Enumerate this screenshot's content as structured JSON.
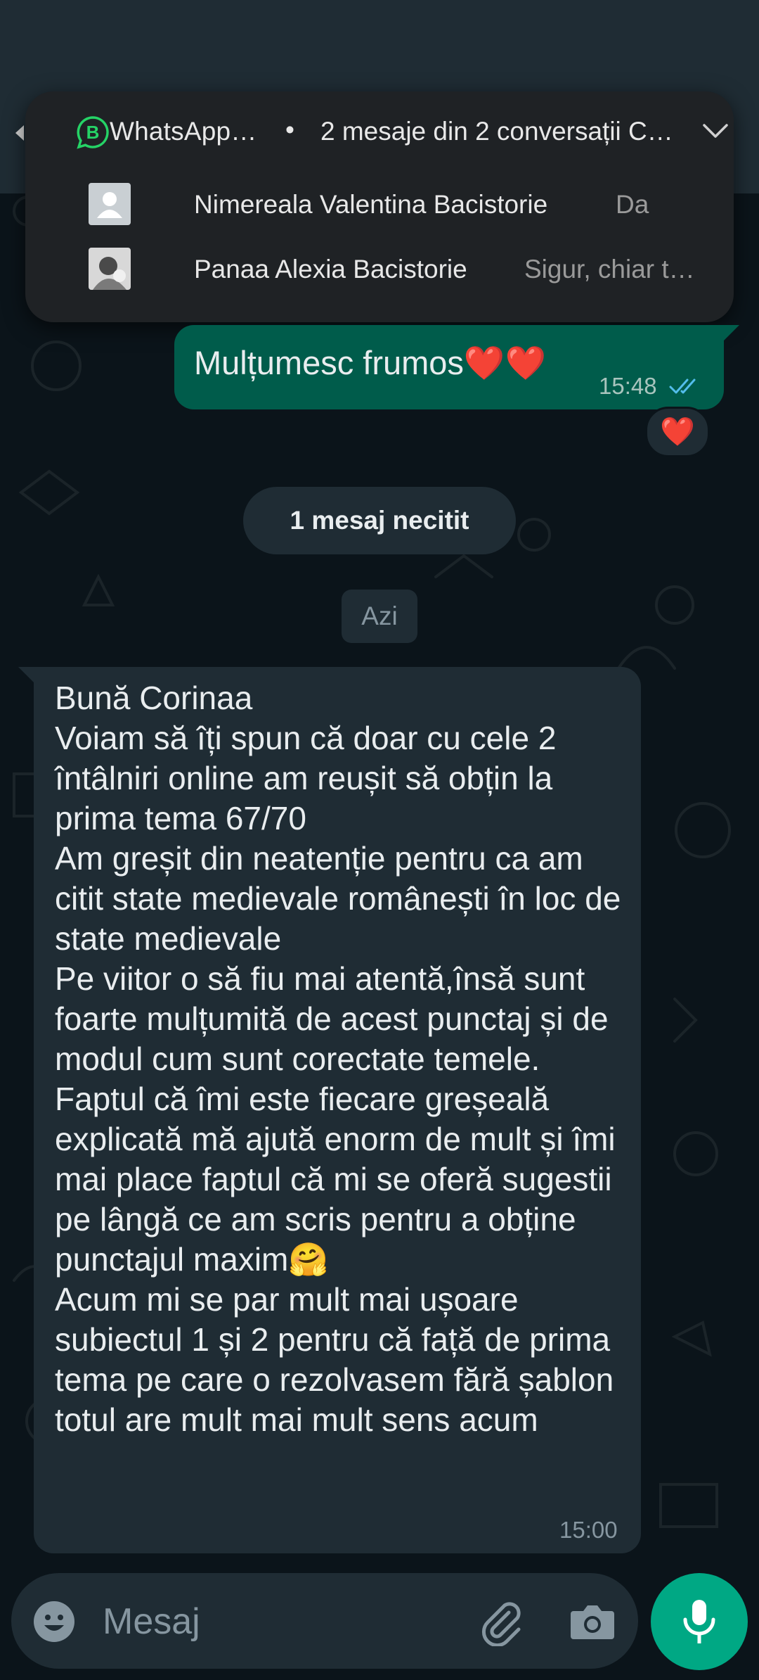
{
  "notification": {
    "app_name": "WhatsApp…",
    "separator": "•",
    "summary": "2 mesaje din 2 conversații  C…",
    "conversations": [
      {
        "name": "Nimereala Valentina Bacistorie",
        "message": "Da"
      },
      {
        "name": "Panaa Alexia Bacistorie",
        "message": "Sigur, chiar t…"
      }
    ]
  },
  "chat": {
    "outgoing": {
      "text": "Mulțumesc frumos❤️❤️",
      "time": "15:48",
      "status": "read",
      "reaction": "❤️"
    },
    "unread_banner": "1 mesaj necitit",
    "date_separator": "Azi",
    "incoming": {
      "text": "Bună Corinaa\nVoiam să îți spun că doar cu cele 2 întâlniri online am reușit să obțin la prima tema 67/70\nAm greșit din neatenție pentru ca am citit state medievale românești în loc de state medievale\nPe viitor o să fiu mai atentă,însă sunt foarte mulțumită de acest punctaj și de modul cum sunt corectate temele. Faptul că îmi este fiecare greșeală explicată mă ajută enorm de mult și îmi mai place faptul că mi se oferă sugestii pe lângă ce am scris pentru a obține punctajul maxim🤗\nAcum mi se par mult mai ușoare subiectul 1 și 2 pentru că față de prima tema pe care o rezolvasem fără șablon totul are mult mai mult sens acum",
      "time": "15:00"
    }
  },
  "composer": {
    "placeholder": "Mesaj"
  },
  "colors": {
    "background": "#0b141a",
    "outgoing_bubble": "#005c4b",
    "incoming_bubble": "#1f2c34",
    "accent": "#00a884",
    "read_ticks": "#53bdeb"
  }
}
